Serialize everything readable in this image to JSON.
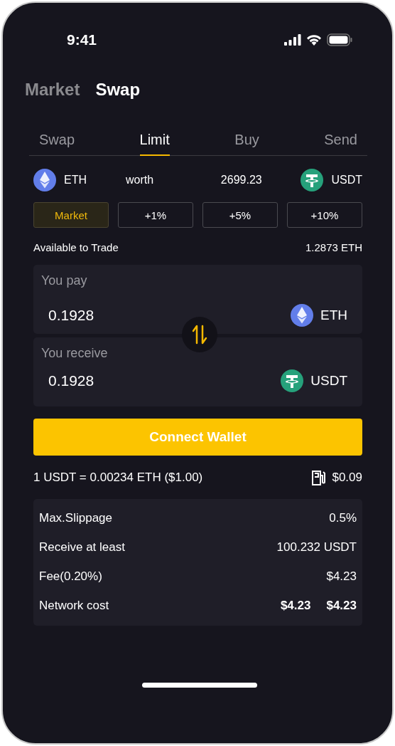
{
  "status_bar": {
    "time": "9:41"
  },
  "header_tabs": [
    {
      "label": "Market",
      "selected": false
    },
    {
      "label": "Swap",
      "selected": true
    }
  ],
  "tabs": [
    {
      "label": "Swap",
      "selected": false
    },
    {
      "label": "Limit",
      "selected": true
    },
    {
      "label": "Buy",
      "selected": false
    },
    {
      "label": "Send",
      "selected": false
    }
  ],
  "pair": {
    "from": {
      "symbol": "ETH",
      "kind": "eth"
    },
    "worth_label": "worth",
    "price": "2699.23",
    "to": {
      "symbol": "USDT",
      "kind": "usdt"
    }
  },
  "presets": [
    {
      "label": "Market",
      "selected": true
    },
    {
      "label": "+1%",
      "selected": false
    },
    {
      "label": "+5%",
      "selected": false
    },
    {
      "label": "+10%",
      "selected": false
    }
  ],
  "available": {
    "label": "Available to Trade",
    "value": "1.2873 ETH"
  },
  "pay": {
    "label": "You pay",
    "amount": "0.1928",
    "token": {
      "symbol": "ETH",
      "kind": "eth"
    }
  },
  "receive": {
    "label": "You receive",
    "amount": "0.1928",
    "token": {
      "symbol": "USDT",
      "kind": "usdt"
    }
  },
  "connect_button": "Connect Wallet",
  "rate": {
    "text": "1 USDT = 0.00234 ETH ($1.00)",
    "gas_fee": "$0.09"
  },
  "details": [
    {
      "label": "Max.Slippage",
      "values": [
        "0.5%"
      ],
      "bold": false
    },
    {
      "label": "Receive at least",
      "values": [
        "100.232 USDT"
      ],
      "bold": false
    },
    {
      "label": "Fee(0.20%)",
      "values": [
        "$4.23"
      ],
      "bold": false
    },
    {
      "label": "Network cost",
      "values": [
        "$4.23",
        "$4.23"
      ],
      "bold": true
    }
  ]
}
